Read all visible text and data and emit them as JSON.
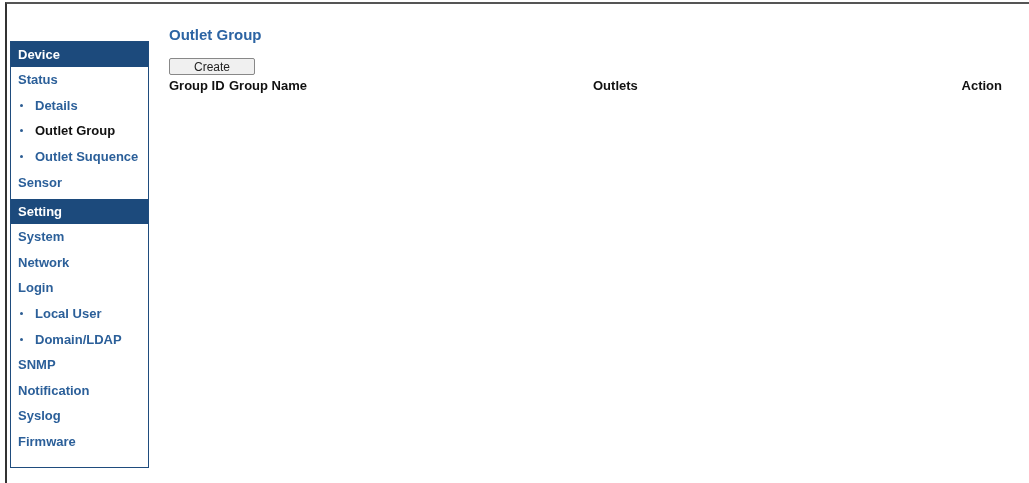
{
  "sidebar": {
    "sections": [
      {
        "title": "Device",
        "items": [
          {
            "label": "Status",
            "selected": false,
            "children": [
              {
                "label": "Details",
                "selected": false
              },
              {
                "label": "Outlet Group",
                "selected": true
              },
              {
                "label": "Outlet Suquence",
                "selected": false
              }
            ]
          },
          {
            "label": "Sensor",
            "selected": false
          }
        ]
      },
      {
        "title": "Setting",
        "items": [
          {
            "label": "System",
            "selected": false
          },
          {
            "label": "Network",
            "selected": false
          },
          {
            "label": "Login",
            "selected": false,
            "children": [
              {
                "label": "Local User",
                "selected": false
              },
              {
                "label": "Domain/LDAP",
                "selected": false
              }
            ]
          },
          {
            "label": "SNMP",
            "selected": false
          },
          {
            "label": "Notification",
            "selected": false
          },
          {
            "label": "Syslog",
            "selected": false
          },
          {
            "label": "Firmware",
            "selected": false
          }
        ]
      }
    ]
  },
  "page_title": "Outlet Group",
  "create_button": "Create",
  "table": {
    "columns": [
      "Group ID",
      "Group Name",
      "Outlets",
      "Action"
    ]
  }
}
